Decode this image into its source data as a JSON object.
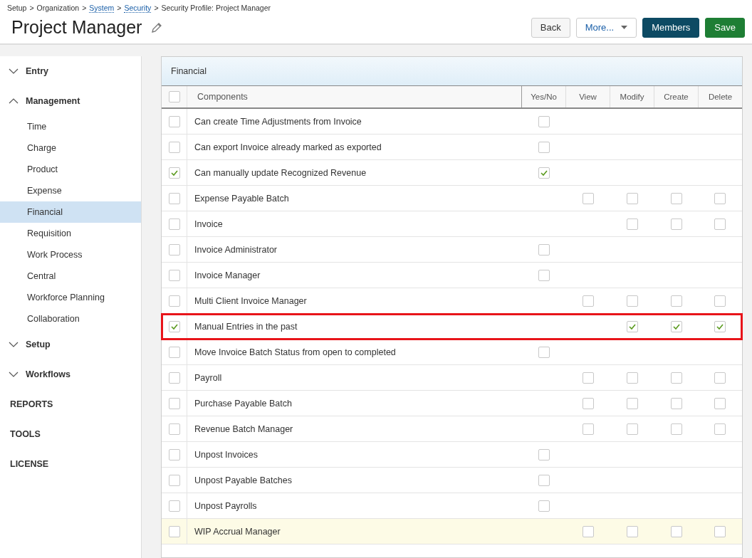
{
  "breadcrumb": [
    {
      "label": "Setup",
      "link": false
    },
    {
      "label": "Organization",
      "link": false
    },
    {
      "label": "System",
      "link": true
    },
    {
      "label": "Security",
      "link": true
    },
    {
      "label": "Security Profile: Project Manager",
      "link": false
    }
  ],
  "breadcrumb_separator": ">",
  "title": "Project Manager",
  "buttons": [
    {
      "label": "Back",
      "kind": "default"
    },
    {
      "label": "More...",
      "kind": "dropdown"
    },
    {
      "label": "Members",
      "kind": "dark"
    },
    {
      "label": "Save",
      "kind": "primary"
    }
  ],
  "sidebar": [
    {
      "label": "Entry",
      "kind": "section",
      "expanded": false
    },
    {
      "label": "Management",
      "kind": "section",
      "expanded": true,
      "children": [
        {
          "label": "Time",
          "selected": false
        },
        {
          "label": "Charge",
          "selected": false
        },
        {
          "label": "Product",
          "selected": false
        },
        {
          "label": "Expense",
          "selected": false
        },
        {
          "label": "Financial",
          "selected": true
        },
        {
          "label": "Requisition",
          "selected": false
        },
        {
          "label": "Work Process",
          "selected": false
        },
        {
          "label": "Central",
          "selected": false
        },
        {
          "label": "Workforce Planning",
          "selected": false
        },
        {
          "label": "Collaboration",
          "selected": false
        }
      ]
    },
    {
      "label": "Setup",
      "kind": "section",
      "expanded": false
    },
    {
      "label": "Workflows",
      "kind": "section",
      "expanded": false
    },
    {
      "label": "REPORTS",
      "kind": "plain"
    },
    {
      "label": "TOOLS",
      "kind": "plain"
    },
    {
      "label": "LICENSE",
      "kind": "plain"
    }
  ],
  "panel": {
    "title": "Financial",
    "select_all": false,
    "columns": [
      "Components",
      "Yes/No",
      "View",
      "Modify",
      "Create",
      "Delete"
    ],
    "rows": [
      {
        "name": "Can create Time Adjustments from Invoice",
        "selected": false,
        "highlighted": false,
        "hovered": false,
        "yes_no": false
      },
      {
        "name": "Can export Invoice already marked as exported",
        "selected": false,
        "highlighted": false,
        "hovered": false,
        "yes_no": false
      },
      {
        "name": "Can manually update Recognized Revenue",
        "selected": true,
        "highlighted": false,
        "hovered": false,
        "yes_no": true
      },
      {
        "name": "Expense Payable Batch",
        "selected": false,
        "highlighted": false,
        "hovered": false,
        "view": false,
        "modify": false,
        "create": false,
        "delete": false
      },
      {
        "name": "Invoice",
        "selected": false,
        "highlighted": false,
        "hovered": false,
        "modify": false,
        "create": false,
        "delete": false
      },
      {
        "name": "Invoice Administrator",
        "selected": false,
        "highlighted": false,
        "hovered": false,
        "yes_no": false
      },
      {
        "name": "Invoice Manager",
        "selected": false,
        "highlighted": false,
        "hovered": false,
        "yes_no": false
      },
      {
        "name": "Multi Client Invoice Manager",
        "selected": false,
        "highlighted": false,
        "hovered": false,
        "view": false,
        "modify": false,
        "create": false,
        "delete": false
      },
      {
        "name": "Manual Entries in the past",
        "selected": true,
        "highlighted": true,
        "hovered": false,
        "modify": true,
        "create": true,
        "delete": true
      },
      {
        "name": "Move Invoice Batch Status from open to completed",
        "selected": false,
        "highlighted": false,
        "hovered": false,
        "yes_no": false
      },
      {
        "name": "Payroll",
        "selected": false,
        "highlighted": false,
        "hovered": false,
        "view": false,
        "modify": false,
        "create": false,
        "delete": false
      },
      {
        "name": "Purchase Payable Batch",
        "selected": false,
        "highlighted": false,
        "hovered": false,
        "view": false,
        "modify": false,
        "create": false,
        "delete": false
      },
      {
        "name": "Revenue Batch Manager",
        "selected": false,
        "highlighted": false,
        "hovered": false,
        "view": false,
        "modify": false,
        "create": false,
        "delete": false
      },
      {
        "name": "Unpost Invoices",
        "selected": false,
        "highlighted": false,
        "hovered": false,
        "yes_no": false
      },
      {
        "name": "Unpost Payable Batches",
        "selected": false,
        "highlighted": false,
        "hovered": false,
        "yes_no": false
      },
      {
        "name": "Unpost Payrolls",
        "selected": false,
        "highlighted": false,
        "hovered": false,
        "yes_no": false
      },
      {
        "name": "WIP Accrual Manager",
        "selected": false,
        "highlighted": false,
        "hovered": true,
        "view": false,
        "modify": false,
        "create": false,
        "delete": false
      }
    ]
  }
}
